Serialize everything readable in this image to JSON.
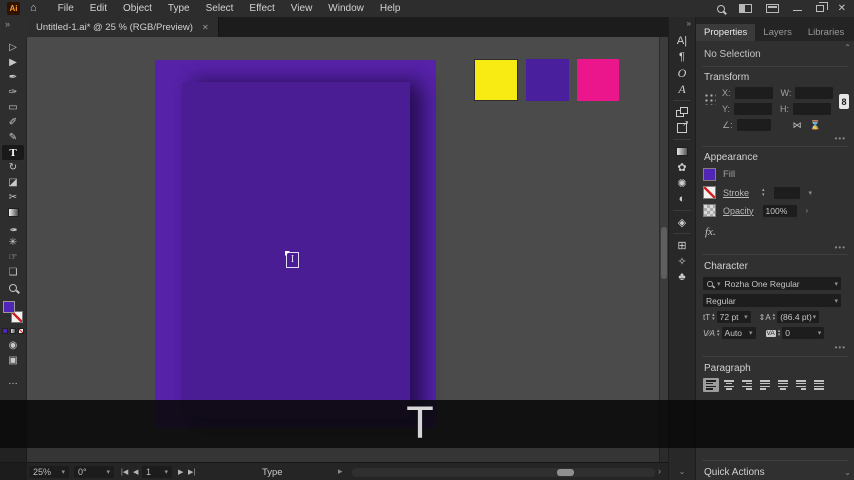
{
  "titlebar": {
    "logo": "Ai",
    "menus": [
      "File",
      "Edit",
      "Object",
      "Type",
      "Select",
      "Effect",
      "View",
      "Window",
      "Help"
    ]
  },
  "tab": {
    "title": "Untitled-1.ai* @ 25 % (RGB/Preview)",
    "close": "✕"
  },
  "icons": {
    "home": "⌂",
    "collapse": "»",
    "selection": "▷",
    "direct_selection": "▶",
    "pen": "✒",
    "curvature": "✑",
    "rectangle": "▭",
    "paintbrush": "✐",
    "shaper": "✎",
    "type": "T",
    "rotate": "↻",
    "eraser": "◪",
    "scissors": "✂",
    "eyedropper": "✒",
    "symbol_sprayer": "✳",
    "hand": "☞",
    "artboard": "❏",
    "draw_mode": "◉",
    "screen_mode": "▣",
    "ellipsis": "…",
    "dock_character": "A|",
    "dock_paragraph": "¶",
    "dock_opentype": "O",
    "dock_glyphs": "A",
    "dock_color": "✿",
    "dock_color_guide": "✺",
    "dock_transparency": "◐",
    "dock_3d": "◈",
    "dock_artboards": "⊞",
    "dock_intertwine": "✧",
    "dock_symbols": "♣",
    "chain": "8",
    "flip_h": "⋈",
    "flip_v": "⌛",
    "more": "•••",
    "caret_up": "⌃",
    "caret_down": "⌄",
    "dropdown": "▾",
    "step_up": "▴",
    "step_down": "▾",
    "search_dd": "▾",
    "size_icon": "tT",
    "leading_icon": "⇕A",
    "kerning_icon": "V∕A",
    "tracking_icon": "VA",
    "nav_first": "|◀",
    "nav_prev": "◀",
    "nav_next": "▶",
    "nav_last": "▶|",
    "status_menu": "▸",
    "chevron_right": "›"
  },
  "colors": {
    "artwork_outer": "#5622A8",
    "artwork_inner": "#4A1D94",
    "fill": "#5126B6"
  },
  "canvas": {
    "swatches": [
      {
        "name": "yellow",
        "color": "#F7EB13"
      },
      {
        "name": "purple",
        "color": "#4A1F9E"
      },
      {
        "name": "pink",
        "color": "#EB158C"
      }
    ]
  },
  "panel": {
    "tabs": [
      "Properties",
      "Layers",
      "Libraries"
    ],
    "selection_status": "No Selection",
    "transform": {
      "title": "Transform",
      "x": "X:",
      "y": "Y:",
      "w": "W:",
      "h": "H:",
      "angle": "∠:"
    },
    "appearance": {
      "title": "Appearance",
      "fill": "Fill",
      "stroke": "Stroke",
      "opacity": "Opacity",
      "opacity_value": "100%",
      "fx": "fx."
    },
    "character": {
      "title": "Character",
      "font": "Rozha One Regular",
      "style": "Regular",
      "size": "72 pt",
      "leading": "(86.4 pt)",
      "kerning": "Auto",
      "tracking": "0"
    },
    "paragraph": {
      "title": "Paragraph"
    },
    "quick_actions": "Quick Actions"
  },
  "statusbar": {
    "zoom": "25%",
    "rotation": "0°",
    "artboard": "1",
    "tool": "Type"
  },
  "overlay": {
    "key": "T"
  }
}
